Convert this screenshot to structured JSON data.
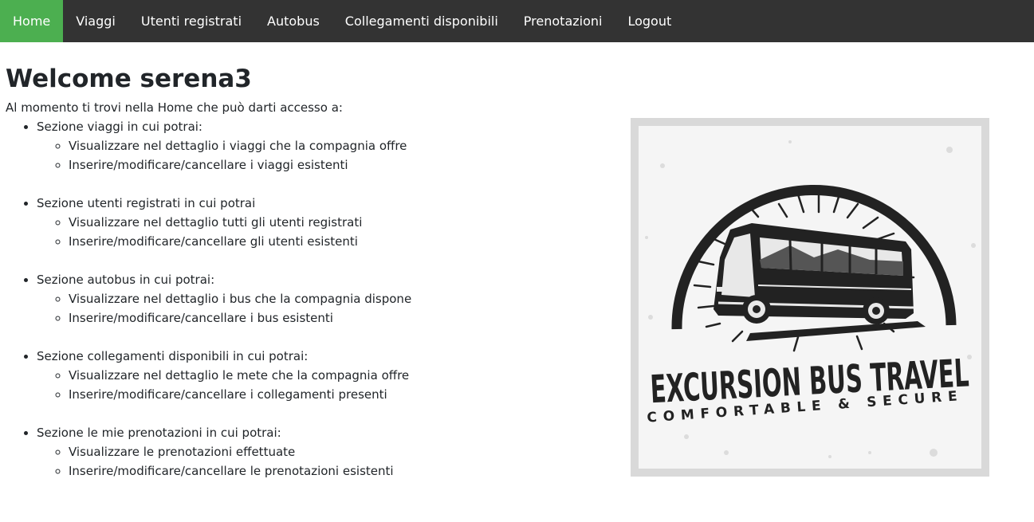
{
  "nav": {
    "items": [
      {
        "label": "Home",
        "active": true
      },
      {
        "label": "Viaggi"
      },
      {
        "label": "Utenti registrati"
      },
      {
        "label": "Autobus"
      },
      {
        "label": "Collegamenti disponibili"
      },
      {
        "label": "Prenotazioni"
      },
      {
        "label": "Logout"
      }
    ]
  },
  "main": {
    "title": "Welcome serena3",
    "intro": "Al momento ti trovi nella Home che può darti accesso a:",
    "sections": [
      {
        "label": "Sezione viaggi in cui potrai:",
        "items": [
          "Visualizzare nel dettaglio i viaggi che la compagnia offre",
          "Inserire/modificare/cancellare i viaggi esistenti"
        ]
      },
      {
        "label": "Sezione utenti registrati in cui potrai",
        "items": [
          "Visualizzare nel dettaglio tutti gli utenti registrati",
          "Inserire/modificare/cancellare gli utenti esistenti"
        ]
      },
      {
        "label": "Sezione autobus in cui potrai:",
        "items": [
          "Visualizzare nel dettaglio i bus che la compagnia dispone",
          "Inserire/modificare/cancellare i bus esistenti"
        ]
      },
      {
        "label": "Sezione collegamenti disponibili in cui potrai:",
        "items": [
          "Visualizzare nel dettaglio le mete che la compagnia offre",
          "Inserire/modificare/cancellare i collegamenti presenti"
        ]
      },
      {
        "label": "Sezione le mie prenotazioni in cui potrai:",
        "items": [
          "Visualizzare le prenotazioni effettuate",
          "Inserire/modificare/cancellare le prenotazioni esistenti"
        ]
      }
    ]
  },
  "logo": {
    "title": "EXCURSION BUS TRAVEL",
    "tagline": "COMFORTABLE & SECURE"
  },
  "colors": {
    "nav_bg": "#333333",
    "nav_active": "#4caf50",
    "nav_text": "#ffffff",
    "logo_ink": "#222222",
    "logo_bg": "#d9d9d9"
  }
}
